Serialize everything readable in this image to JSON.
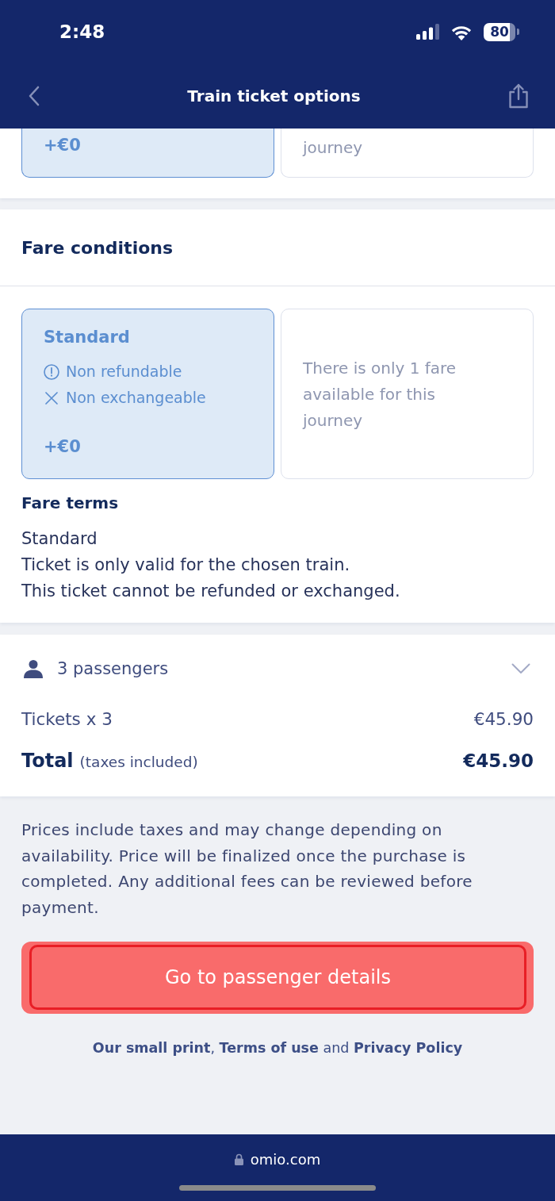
{
  "status_bar": {
    "time": "2:48",
    "battery": "80"
  },
  "nav": {
    "title": "Train ticket options"
  },
  "previous_fares": {
    "cards": [
      {
        "kind": "fare",
        "selected": true,
        "price": "+€0"
      },
      {
        "kind": "notice",
        "selected": false,
        "text": "journey"
      }
    ]
  },
  "fare_conditions": {
    "title": "Fare conditions",
    "cards": [
      {
        "kind": "fare",
        "selected": true,
        "name": "Standard",
        "conditions": [
          {
            "kind": "warning",
            "text": "Non refundable"
          },
          {
            "kind": "cross",
            "text": "Non exchangeable"
          }
        ],
        "price": "+€0"
      },
      {
        "kind": "notice",
        "selected": false,
        "text": "There is only 1 fare available for this journey"
      }
    ],
    "terms_title": "Fare terms",
    "terms": [
      "Standard",
      "Ticket is only valid for the chosen train.",
      "This ticket cannot be refunded or exchanged."
    ]
  },
  "summary": {
    "passengers": "3 passengers",
    "expanded": false,
    "lines": [
      {
        "kind": "item",
        "label": "Tickets x 3",
        "amount": "€45.90"
      },
      {
        "kind": "total",
        "label": "Total",
        "note": "(taxes included)",
        "amount": "€45.90"
      }
    ]
  },
  "disclaimer": "Prices include taxes and may change depending on availability. Price will be finalized once the purchase is completed. Any additional fees can be reviewed before payment.",
  "primary_button": {
    "label": "Go to passenger details",
    "focused": true
  },
  "legal": [
    {
      "kind": "link",
      "text": "Our small print"
    },
    {
      "kind": "plain",
      "text": ", "
    },
    {
      "kind": "link",
      "text": "Terms of use"
    },
    {
      "kind": "plain",
      "text": " and "
    },
    {
      "kind": "link",
      "text": "Privacy Policy"
    }
  ],
  "browser_bar": {
    "url": "omio.com"
  }
}
